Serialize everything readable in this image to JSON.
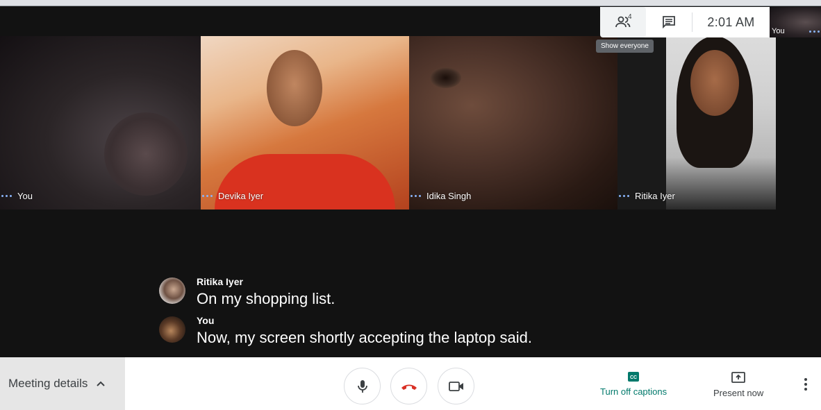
{
  "top_panel": {
    "participant_count": "4",
    "time": "2:01 AM",
    "tooltip": "Show everyone"
  },
  "self_preview": {
    "label": "You"
  },
  "tiles": [
    {
      "name": "You"
    },
    {
      "name": "Devika Iyer"
    },
    {
      "name": "Idika Singh"
    },
    {
      "name": "Ritika Iyer"
    }
  ],
  "captions": [
    {
      "speaker": "Ritika Iyer",
      "text": "On my shopping list."
    },
    {
      "speaker": "You",
      "text": "Now, my screen shortly accepting the laptop said."
    }
  ],
  "bottom_bar": {
    "meeting_details": "Meeting details",
    "captions_label": "Turn off captions",
    "present_label": "Present now"
  },
  "colors": {
    "accent_captions": "#00796b",
    "hangup": "#d93025",
    "name_dots": "#8ab4f8"
  },
  "icons": [
    "people-icon",
    "chat-icon",
    "mic-icon",
    "hangup-icon",
    "camera-icon",
    "closed-captions-icon",
    "present-icon",
    "more-vert-icon",
    "chevron-up-icon"
  ]
}
